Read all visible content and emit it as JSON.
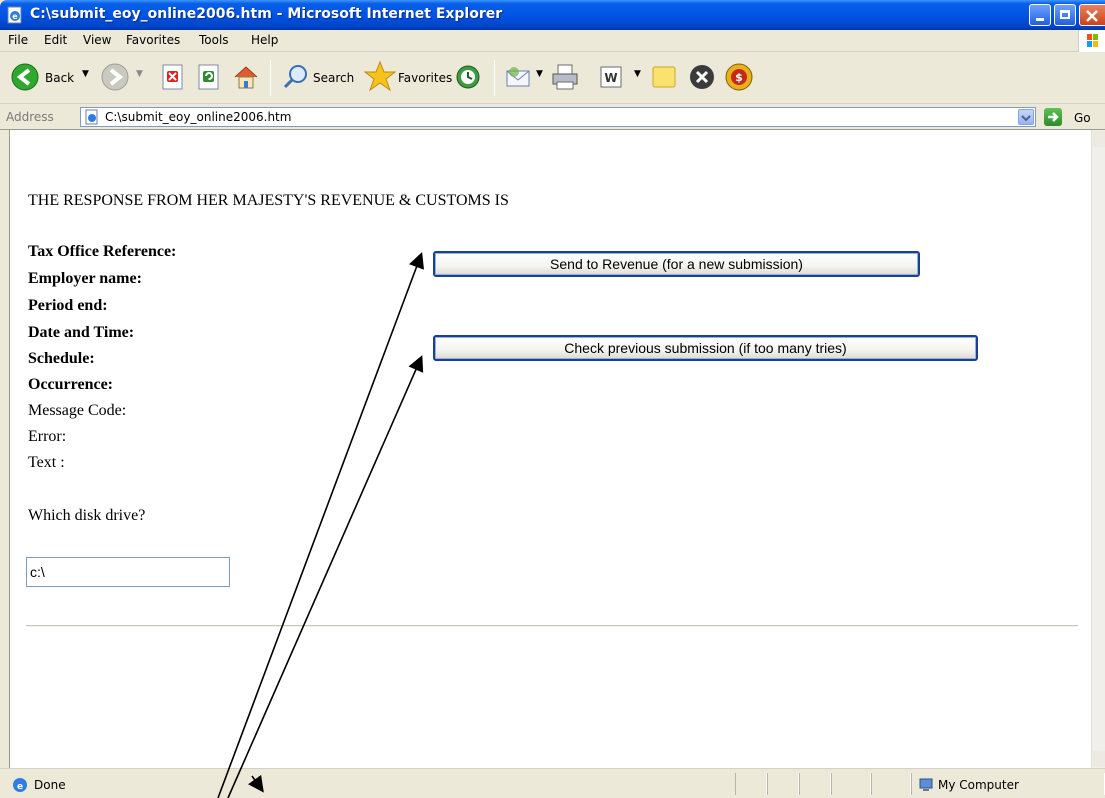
{
  "window": {
    "title": "C:\\submit_eoy_online2006.htm - Microsoft Internet Explorer"
  },
  "menu": {
    "items": [
      "File",
      "Edit",
      "View",
      "Favorites",
      "Tools",
      "Help"
    ]
  },
  "toolbar": {
    "back_label": "Back",
    "search_label": "Search",
    "favorites_label": "Favorites"
  },
  "address": {
    "label": "Address",
    "value": "C:\\submit_eoy_online2006.htm",
    "go_label": "Go"
  },
  "page": {
    "heading": "THE RESPONSE FROM HER MAJESTY'S REVENUE & CUSTOMS IS",
    "fields": [
      {
        "label": "Tax Office Reference:",
        "bold": true
      },
      {
        "label": "Employer name:",
        "bold": true
      },
      {
        "label": "Period end:",
        "bold": true
      },
      {
        "label": "Date and Time:",
        "bold": true
      },
      {
        "label": "Schedule:",
        "bold": true
      },
      {
        "label": "Occurrence:",
        "bold": true
      },
      {
        "label": "Message Code:",
        "bold": false
      },
      {
        "label": "Error:",
        "bold": false
      },
      {
        "label": "Text :",
        "bold": false
      }
    ],
    "send_button": "Send to Revenue (for a new submission)",
    "check_button": "Check previous submission (if too many tries)",
    "drive_prompt": "Which disk drive?",
    "drive_value": "c:\\"
  },
  "status": {
    "text": "Done",
    "zone": "My Computer"
  },
  "colors": {
    "titlebar": "#0055E5",
    "button_border": "#1C3F8E",
    "frame": "#ECE9D8"
  }
}
